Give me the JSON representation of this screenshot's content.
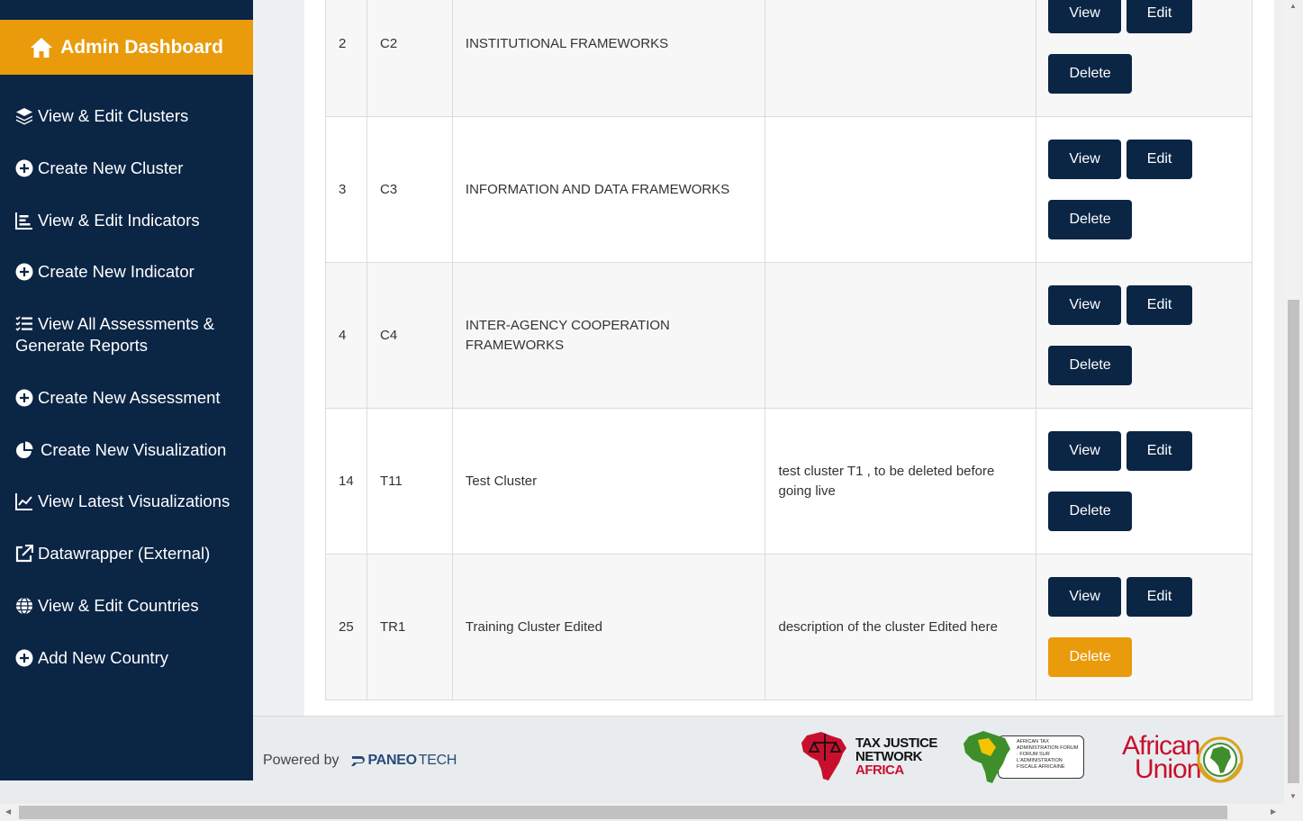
{
  "sidebar": {
    "brand": "Admin Dashboard",
    "items": [
      {
        "label": "View & Edit Clusters",
        "icon": "layers-icon"
      },
      {
        "label": "Create New Cluster",
        "icon": "plus-circle-icon"
      },
      {
        "label": "View & Edit Indicators",
        "icon": "bar-chart-icon"
      },
      {
        "label": "Create New Indicator",
        "icon": "plus-circle-icon"
      },
      {
        "label_line1": "View All Assessments &",
        "label_line2": "Generate Reports",
        "icon": "list-icon"
      },
      {
        "label": "Create New Assessment",
        "icon": "plus-circle-icon"
      },
      {
        "label": "Create New Visualization",
        "icon": "pie-chart-icon"
      },
      {
        "label": "View Latest Visualizations",
        "icon": "line-chart-icon"
      },
      {
        "label": "Datawrapper (External)",
        "icon": "external-link-icon"
      },
      {
        "label": "View & Edit Countries",
        "icon": "globe-icon"
      },
      {
        "label": "Add New Country",
        "icon": "plus-circle-icon"
      }
    ]
  },
  "table": {
    "rows": [
      {
        "id": "2",
        "code": "C2",
        "name": "INSTITUTIONAL FRAMEWORKS",
        "description": ""
      },
      {
        "id": "3",
        "code": "C3",
        "name": "INFORMATION AND DATA FRAMEWORKS",
        "description": ""
      },
      {
        "id": "4",
        "code": "C4",
        "name": "INTER-AGENCY COOPERATION FRAMEWORKS",
        "description": ""
      },
      {
        "id": "14",
        "code": "T11",
        "name": "Test Cluster",
        "description": "test cluster T1 , to be deleted before going live"
      },
      {
        "id": "25",
        "code": "TR1",
        "name": "Training Cluster Edited",
        "description": "description of the cluster Edited here"
      }
    ],
    "actions": {
      "view": "View",
      "edit": "Edit",
      "delete": "Delete"
    }
  },
  "footer": {
    "powered_by": "Powered by",
    "paneo_bold": "PANEO",
    "paneo_light": "TECH",
    "tjn_line1": "TAX JUSTICE",
    "tjn_line2": "NETWORK",
    "tjn_line3": "AFRICA",
    "ataf_text": "AFRICAN TAX ADMINISTRATION FORUM · FORUM SUR L'ADMINISTRATION FISCALE AFRICAINE",
    "au_line1": "African",
    "au_line2": "Union"
  },
  "colors": {
    "sidebar_bg": "#0b2545",
    "accent": "#e99b0b",
    "button_bg": "#0b2545"
  }
}
